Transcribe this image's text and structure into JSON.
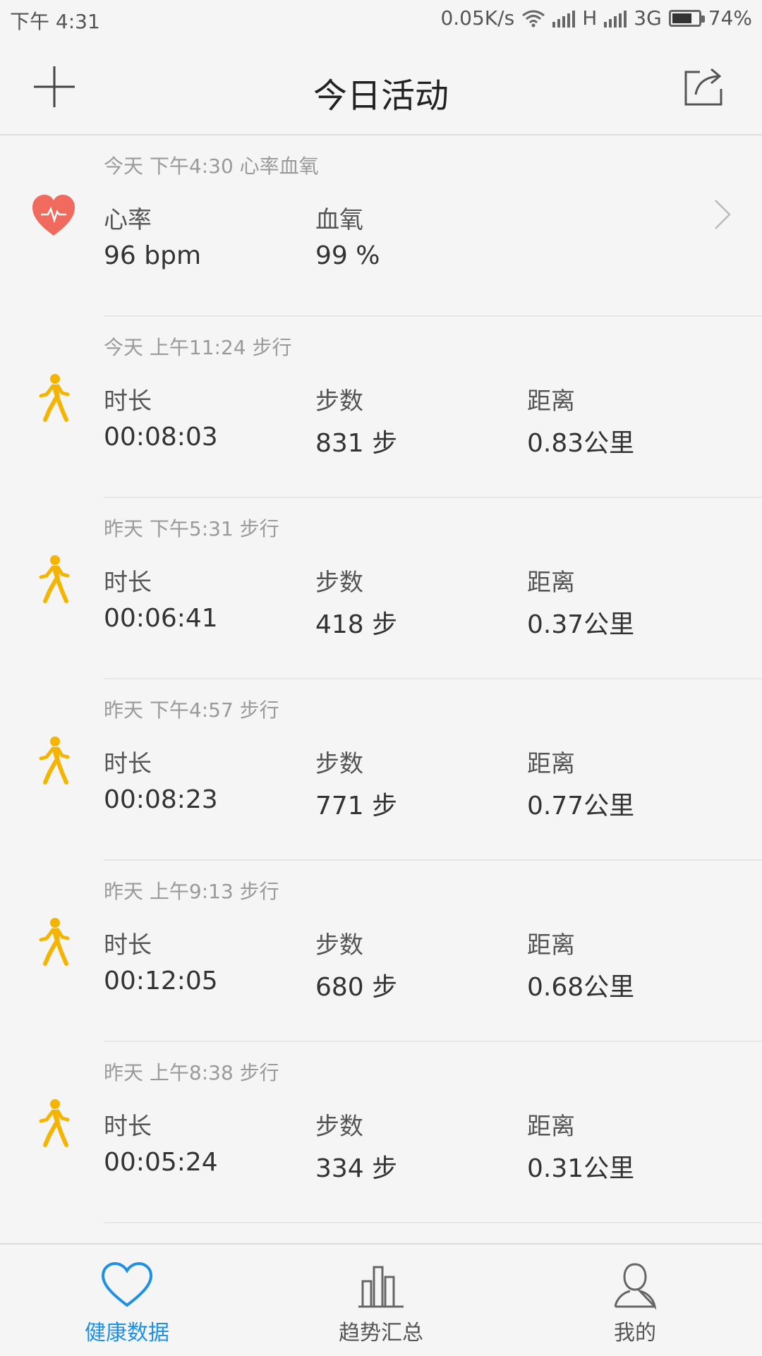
{
  "status_bar": {
    "time": "下午 4:31",
    "net_speed": "0.05K/s",
    "signal1": "H",
    "signal2": "3G",
    "battery_pct": "74%",
    "battery_level": 0.74
  },
  "header": {
    "title": "今日活动",
    "add_icon": "plus-icon",
    "share_icon": "share-icon"
  },
  "activities": [
    {
      "time": "今天 下午4:30 心率血氧",
      "icon": "heart-rate-icon",
      "metrics": [
        {
          "label": "心率",
          "value": "96 bpm"
        },
        {
          "label": "血氧",
          "value": "99 %"
        }
      ]
    },
    {
      "time": "今天 上午11:24 步行",
      "icon": "walking-icon",
      "metrics": [
        {
          "label": "时长",
          "value": "00:08:03"
        },
        {
          "label": "步数",
          "value": "831 步"
        },
        {
          "label": "距离",
          "value": "0.83公里"
        }
      ]
    },
    {
      "time": "昨天 下午5:31 步行",
      "icon": "walking-icon",
      "metrics": [
        {
          "label": "时长",
          "value": "00:06:41"
        },
        {
          "label": "步数",
          "value": "418 步"
        },
        {
          "label": "距离",
          "value": "0.37公里"
        }
      ]
    },
    {
      "time": "昨天 下午4:57 步行",
      "icon": "walking-icon",
      "metrics": [
        {
          "label": "时长",
          "value": "00:08:23"
        },
        {
          "label": "步数",
          "value": "771 步"
        },
        {
          "label": "距离",
          "value": "0.77公里"
        }
      ]
    },
    {
      "time": "昨天 上午9:13 步行",
      "icon": "walking-icon",
      "metrics": [
        {
          "label": "时长",
          "value": "00:12:05"
        },
        {
          "label": "步数",
          "value": "680 步"
        },
        {
          "label": "距离",
          "value": "0.68公里"
        }
      ]
    },
    {
      "time": "昨天 上午8:38 步行",
      "icon": "walking-icon",
      "metrics": [
        {
          "label": "时长",
          "value": "00:05:24"
        },
        {
          "label": "步数",
          "value": "334 步"
        },
        {
          "label": "距离",
          "value": "0.31公里"
        }
      ]
    }
  ],
  "tabs": [
    {
      "label": "健康数据",
      "icon": "heart-outline-icon",
      "active": true
    },
    {
      "label": "趋势汇总",
      "icon": "bar-chart-icon",
      "active": false
    },
    {
      "label": "我的",
      "icon": "user-icon",
      "active": false
    }
  ],
  "colors": {
    "accent": "#1e90e6",
    "heart": "#f06a5e",
    "walker": "#f4b400"
  }
}
